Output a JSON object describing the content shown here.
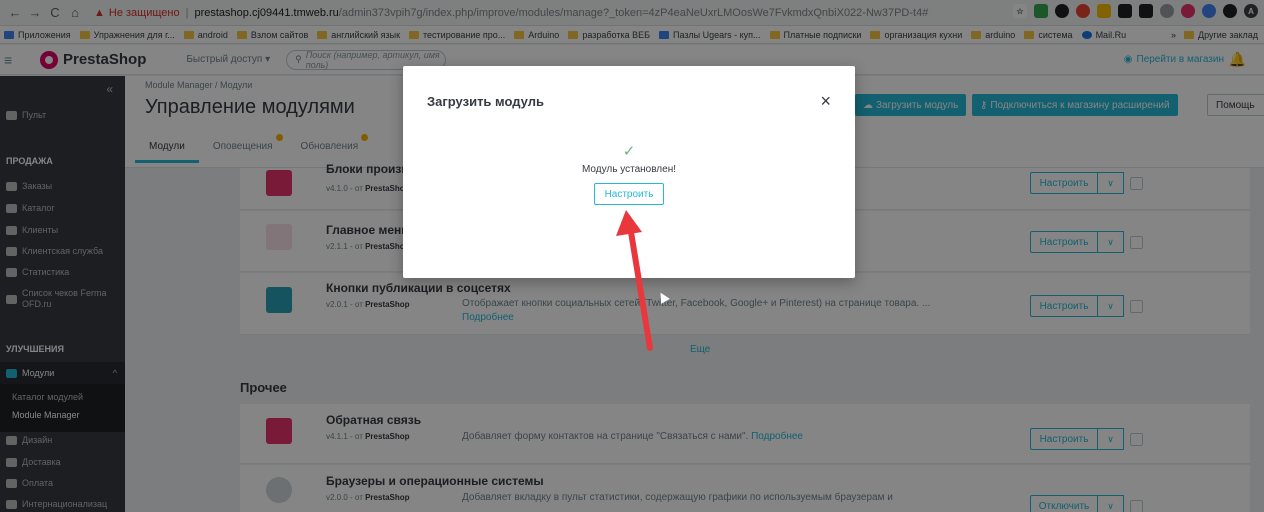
{
  "browser": {
    "insecure_label": "Не защищено",
    "url_host": "prestashop.cj09441.tmweb.ru",
    "url_path": "/admin373vpih7g/index.php/improve/modules/manage?_token=4zP4eaNeUxrLMOosWe7FvkmdxQnbiX022-Nw37PD-t4#",
    "bookmarks": [
      "Приложения",
      "Упражнения для г...",
      "android",
      "Взлом сайтов",
      "английский язык",
      "тестирование про...",
      "Arduino",
      "разработка ВЕБ",
      "Пазлы Ugears - куп...",
      "Платные подписки",
      "организация кухни",
      "arduino",
      "система",
      "Mail.Ru"
    ],
    "bookmarks_more": "»",
    "other_bookmarks": "Другие заклад"
  },
  "header": {
    "logo_text": "PrestaShop",
    "quick_access": "Быстрый доступ ▾",
    "search_placeholder": "Поиск (например, артикул, имя поль)",
    "goto_shop": "Перейти в магазин"
  },
  "sidebar": {
    "dashboard": "Пульт",
    "section_sell": "ПРОДАЖА",
    "sell_items": [
      "Заказы",
      "Каталог",
      "Клиенты",
      "Клиентская служба",
      "Статистика",
      "Список чеков Ferma OFD.ru"
    ],
    "section_improve": "УЛУЧШЕНИЯ",
    "modules": "Модули",
    "modules_sub": [
      "Каталог модулей",
      "Module Manager"
    ],
    "after_items": [
      "Дизайн",
      "Доставка",
      "Оплата",
      "Интернационализац"
    ]
  },
  "page": {
    "breadcrumb": "Module Manager  /  Модули",
    "title": "Управление модулями",
    "tabs": [
      "Модули",
      "Оповещения",
      "Обновления"
    ],
    "upload_button": "Загрузить модуль",
    "connect_button": "Подключиться к магазину расширений",
    "help_button": "Помощь"
  },
  "modules": [
    {
      "name": "Блоки производителей",
      "version": "v4.1.0",
      "author": "PrestaShop",
      "description": ""
    },
    {
      "name": "Главное меню",
      "version": "v2.1.1",
      "author": "PrestaShop",
      "description": ""
    },
    {
      "name": "Кнопки публикации в соцсетях",
      "version": "v2.0.1",
      "author": "PrestaShop",
      "description": "Отображает кнопки социальных сетей (Twitter, Facebook, Google+ и Pinterest) на странице товара. ...",
      "link": "Подробнее"
    },
    {
      "name": "Обратная связь",
      "version": "v4.1.1",
      "author": "PrestaShop",
      "description": "Добавляет форму контактов на странице \"Связаться с нами\".",
      "link": "Подробнее"
    },
    {
      "name": "Браузеры и операционные системы",
      "version": "v2.0.0",
      "author": "PrestaShop",
      "description": "Добавляет вкладку в пульт статистики, содержащую графики по используемым браузерам и"
    }
  ],
  "module_labels": {
    "from": "- от",
    "configure": "Настроить",
    "disable": "Отключить",
    "more": "Еще",
    "section_other": "Прочее"
  },
  "modal": {
    "title": "Загрузить модуль",
    "close": "×",
    "success_icon": "check-icon",
    "message": "Модуль установлен!",
    "configure_button": "Настроить"
  },
  "colors": {
    "accent": "#25b9d7",
    "brand": "#df0067",
    "annotation_arrow": "#e8383d"
  }
}
